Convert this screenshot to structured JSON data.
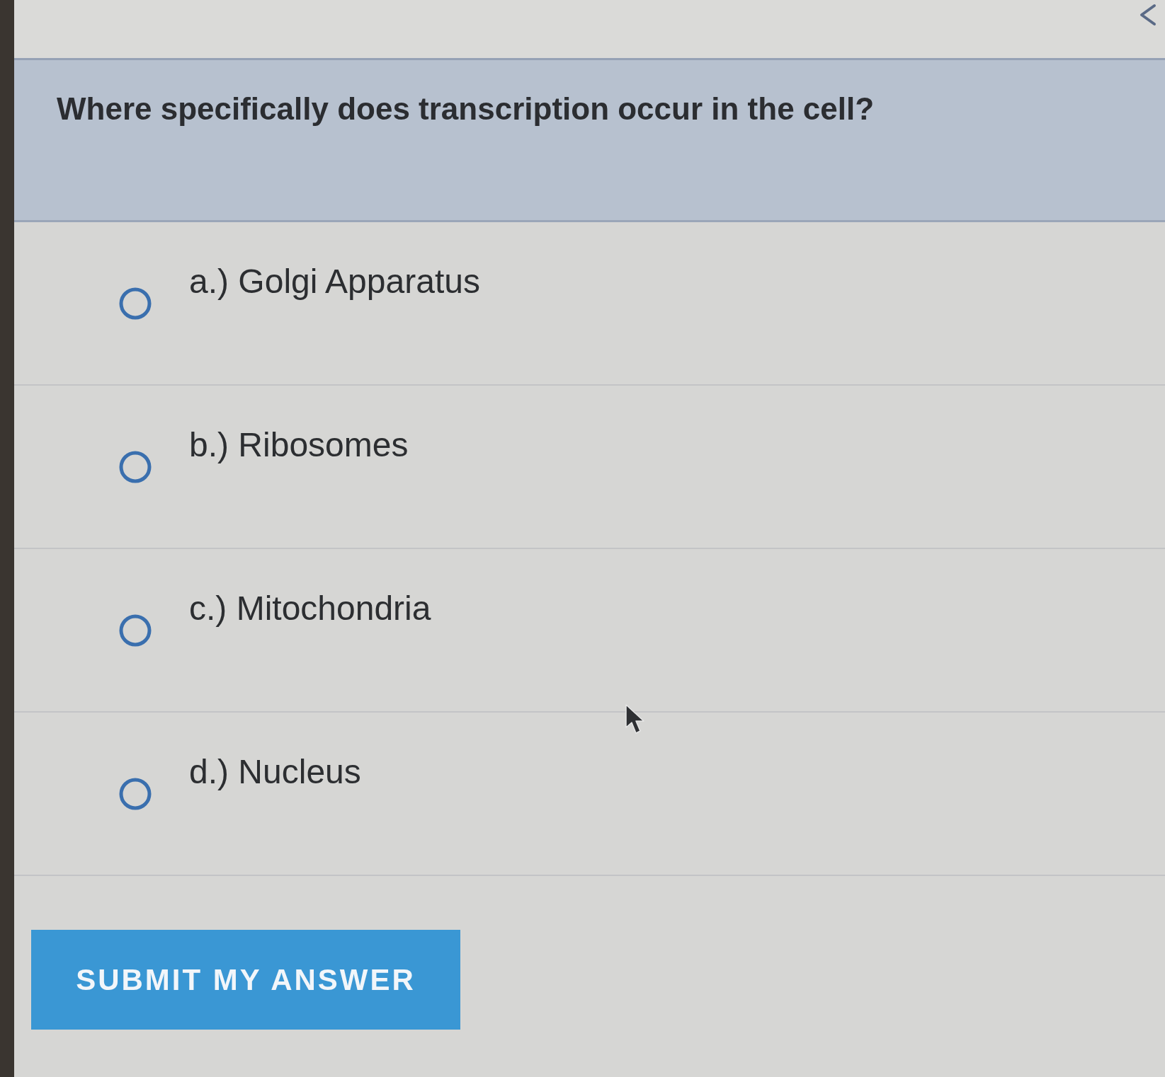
{
  "question": "Where specifically does transcription occur in the cell?",
  "options": [
    {
      "label": "a.) Golgi Apparatus",
      "selected": false
    },
    {
      "label": "b.) Ribosomes",
      "selected": false
    },
    {
      "label": "c.) Mitochondria",
      "selected": false
    },
    {
      "label": "d.) Nucleus",
      "selected": false
    }
  ],
  "submit_button": "SUBMIT MY ANSWER"
}
